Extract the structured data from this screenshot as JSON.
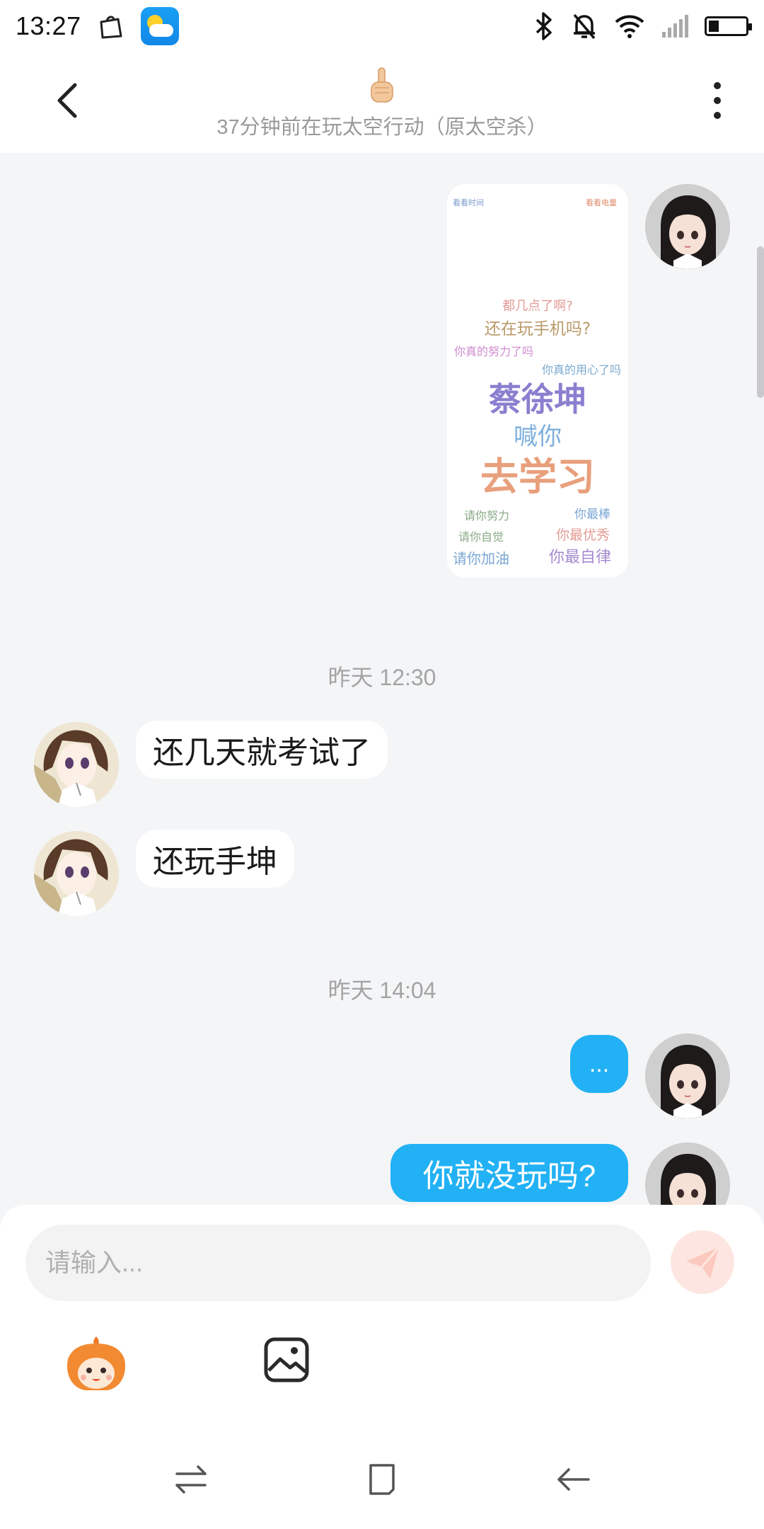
{
  "status_bar": {
    "time": "13:27",
    "icons_left": [
      "bag-notification-icon",
      "weather-app-icon"
    ],
    "icons_right": [
      "bluetooth-icon",
      "mute-bell-icon",
      "wifi-icon",
      "signal-icon",
      "battery-icon"
    ],
    "battery_level": 0.2
  },
  "header": {
    "emoji": "pointing-hand-emoji",
    "subtitle": "37分钟前在玩太空行动（原太空杀）"
  },
  "messages": {
    "image_poster": {
      "corner_left": "看看时间",
      "corner_right": "看看电量",
      "line1": "都几点了啊?",
      "line2": "还在玩手机吗?",
      "line3": "你真的努力了吗",
      "line4": "你真的用心了吗",
      "name": "蔡徐坤",
      "call": "喊你",
      "study": "去学习",
      "encourage": [
        "请你努力",
        "你最棒",
        "请你自觉",
        "你最优秀",
        "请你加油",
        "你最自律"
      ]
    },
    "time1": "昨天 12:30",
    "msg1": "还几天就考试了",
    "msg2": "还玩手坤",
    "time2": "昨天 14:04",
    "msg3": "...",
    "msg4": "你就没玩吗?"
  },
  "composer": {
    "placeholder": "请输入..."
  },
  "colors": {
    "accent_blue": "#22b1f4",
    "background": "#f4f5f7",
    "send_disabled": "#fde6e1"
  }
}
